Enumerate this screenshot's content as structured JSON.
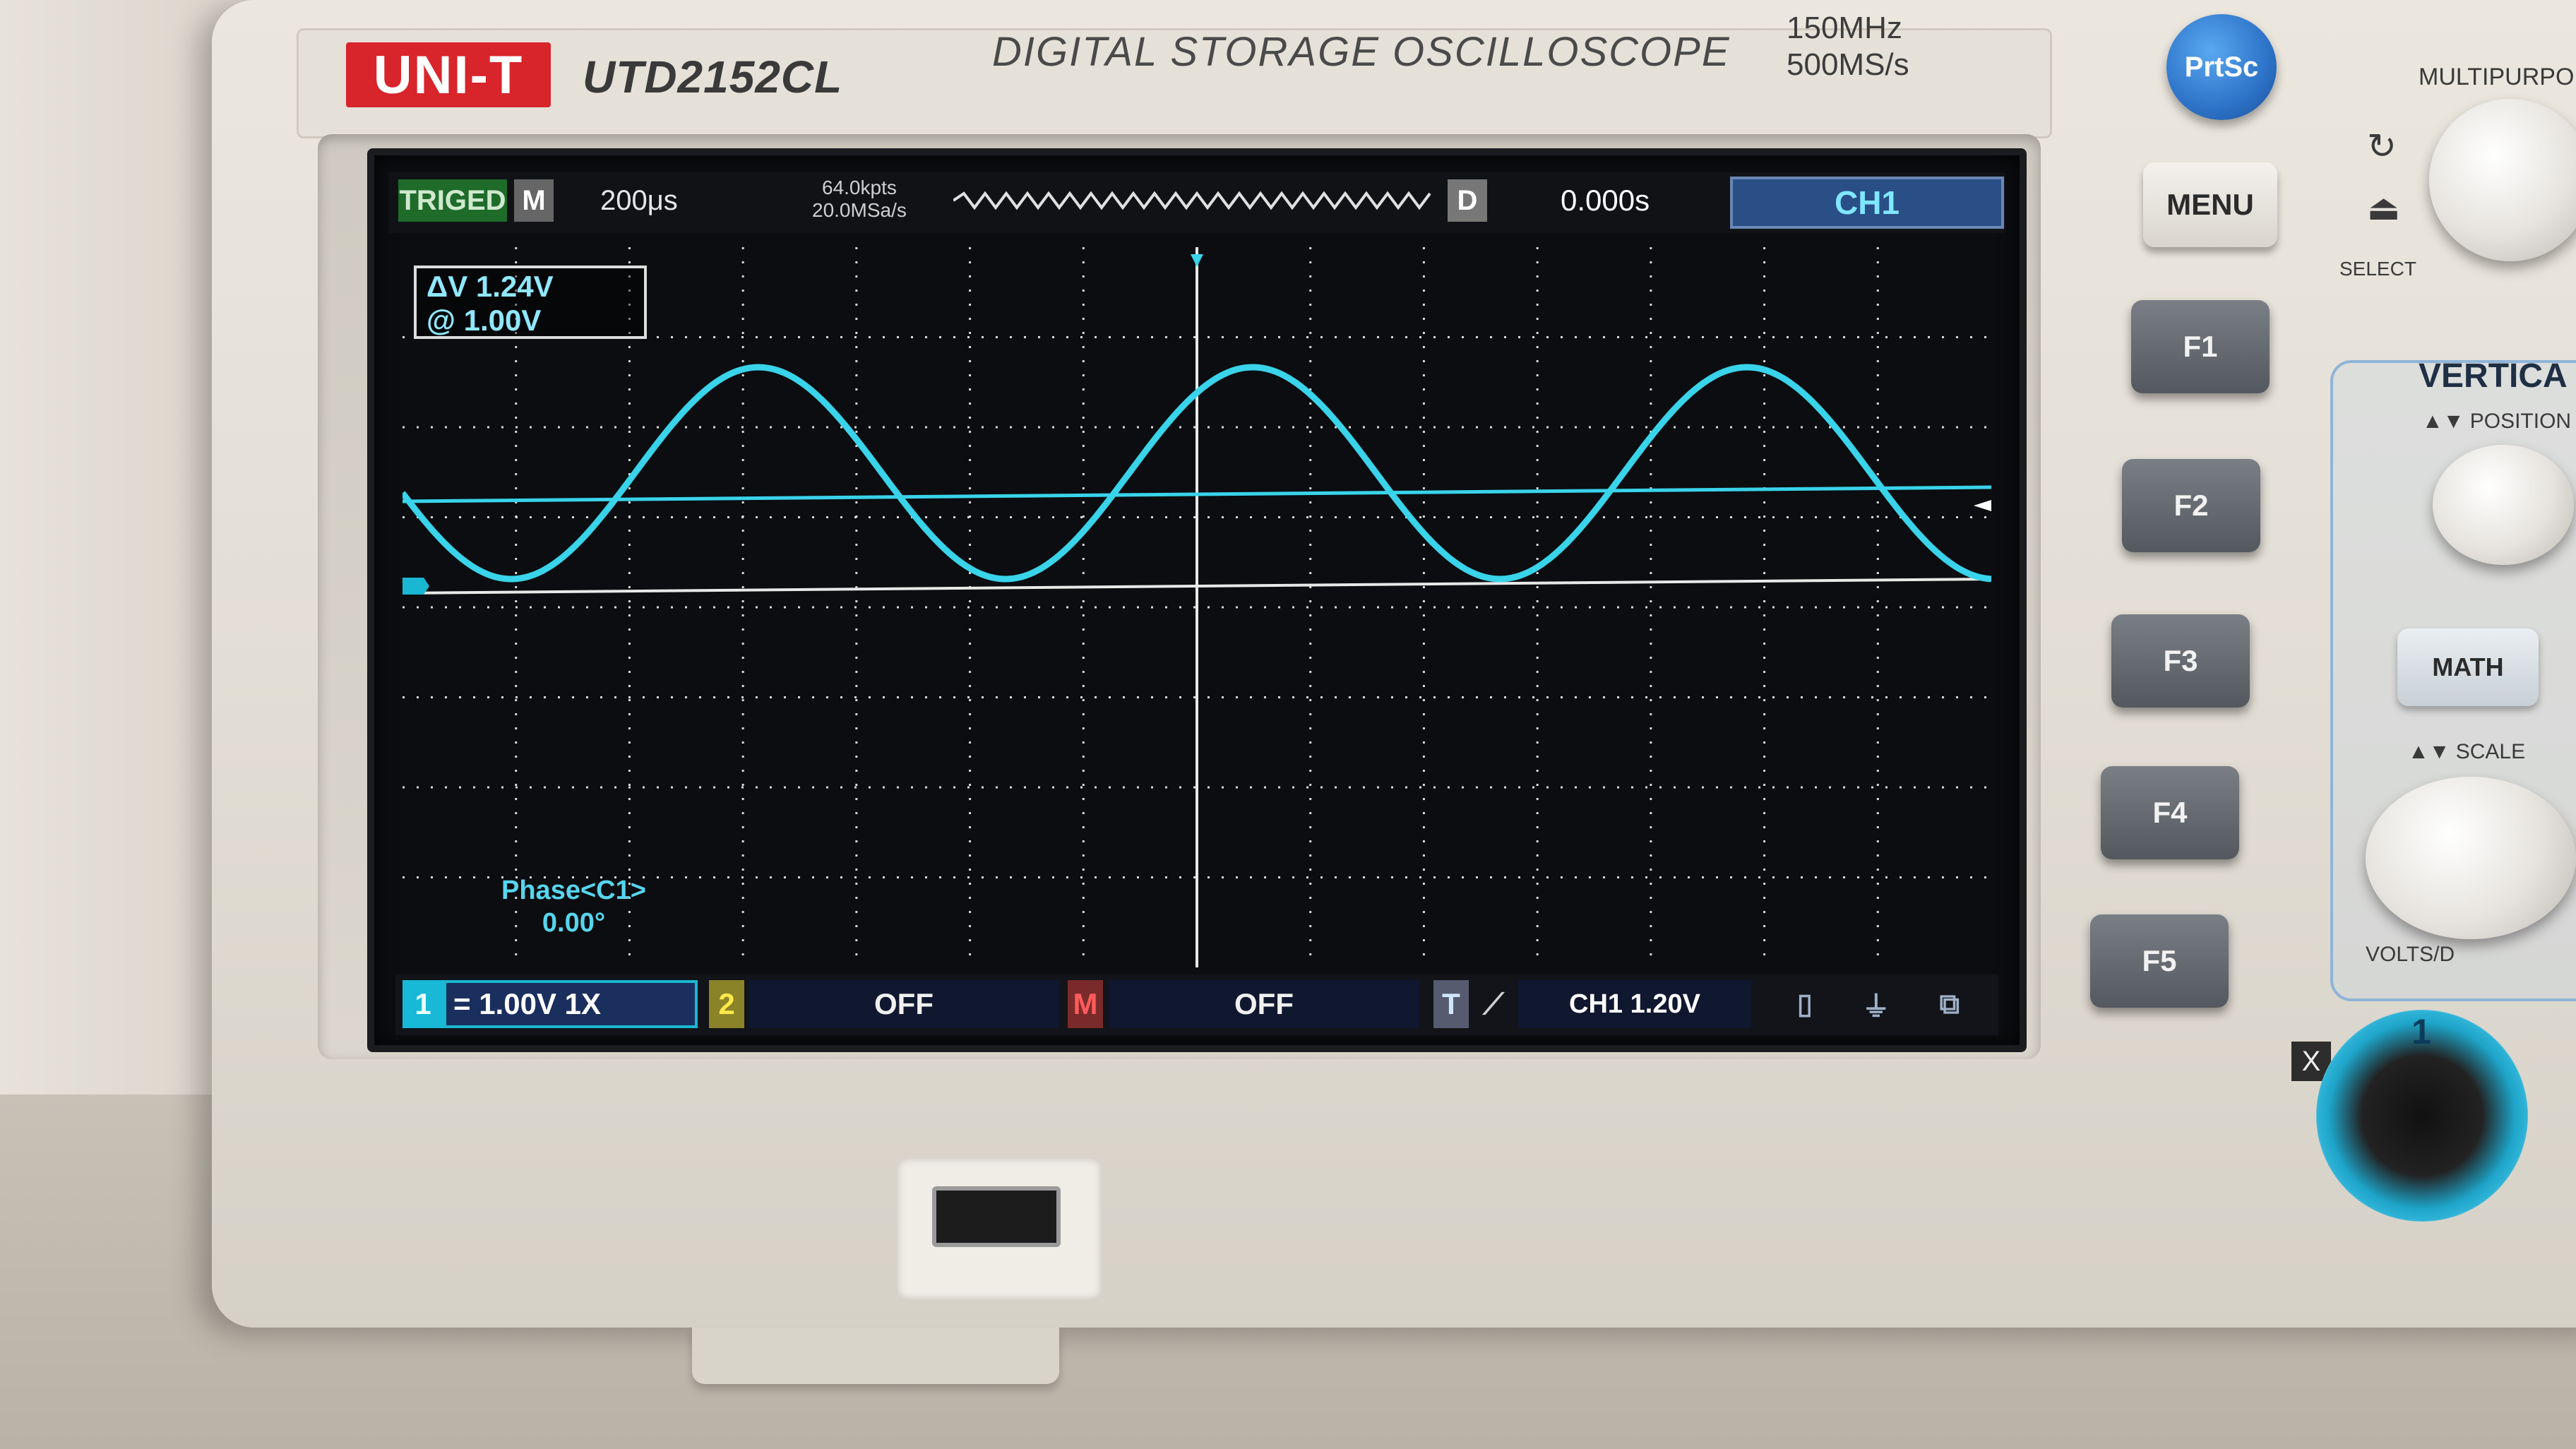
{
  "device": {
    "brand": "UNI-T",
    "model": "UTD2152CL",
    "subtitle": "DIGITAL STORAGE OSCILLOSCOPE",
    "bandwidth": "150MHz",
    "sample_rate_spec": "500MS/s"
  },
  "status_bar": {
    "trigger_status": "TRIGED",
    "mode_badge": "M",
    "timebase": "200μs",
    "memory_depth": "64.0kpts",
    "sample_rate": "20.0MSa/s",
    "delay_badge": "D",
    "horizontal_offset": "0.000s",
    "active_channel": "CH1"
  },
  "cursor_readout": {
    "delta_v": "ΔV 1.24V",
    "at_v": "@ 1.00V"
  },
  "measurement": {
    "label": "Phase<C1>",
    "value": "0.00°"
  },
  "bottom_bar": {
    "ch1_number": "1",
    "ch1_setting": "= 1.00V 1X",
    "ch2_number": "2",
    "ch2_setting": "OFF",
    "math_badge": "M",
    "math_setting": "OFF",
    "trigger_badge": "T",
    "trigger_level": "CH1 1.20V"
  },
  "front_panel": {
    "prtsc": "PrtSc",
    "menu": "MENU",
    "function_keys": [
      "F1",
      "F2",
      "F3",
      "F4",
      "F5"
    ],
    "multipurpose": "MULTIPURPO",
    "select": "SELECT",
    "vertical": "VERTICA",
    "position": "POSITION",
    "math": "MATH",
    "scale": "SCALE",
    "volts_div": "VOLTS/D",
    "input_number": "1",
    "x_label": "X"
  },
  "colors": {
    "trace": "#39d3ea",
    "grid": "#e8e8e8",
    "logo": "#d8242b",
    "ch1_tag": "#2a4e86"
  }
}
